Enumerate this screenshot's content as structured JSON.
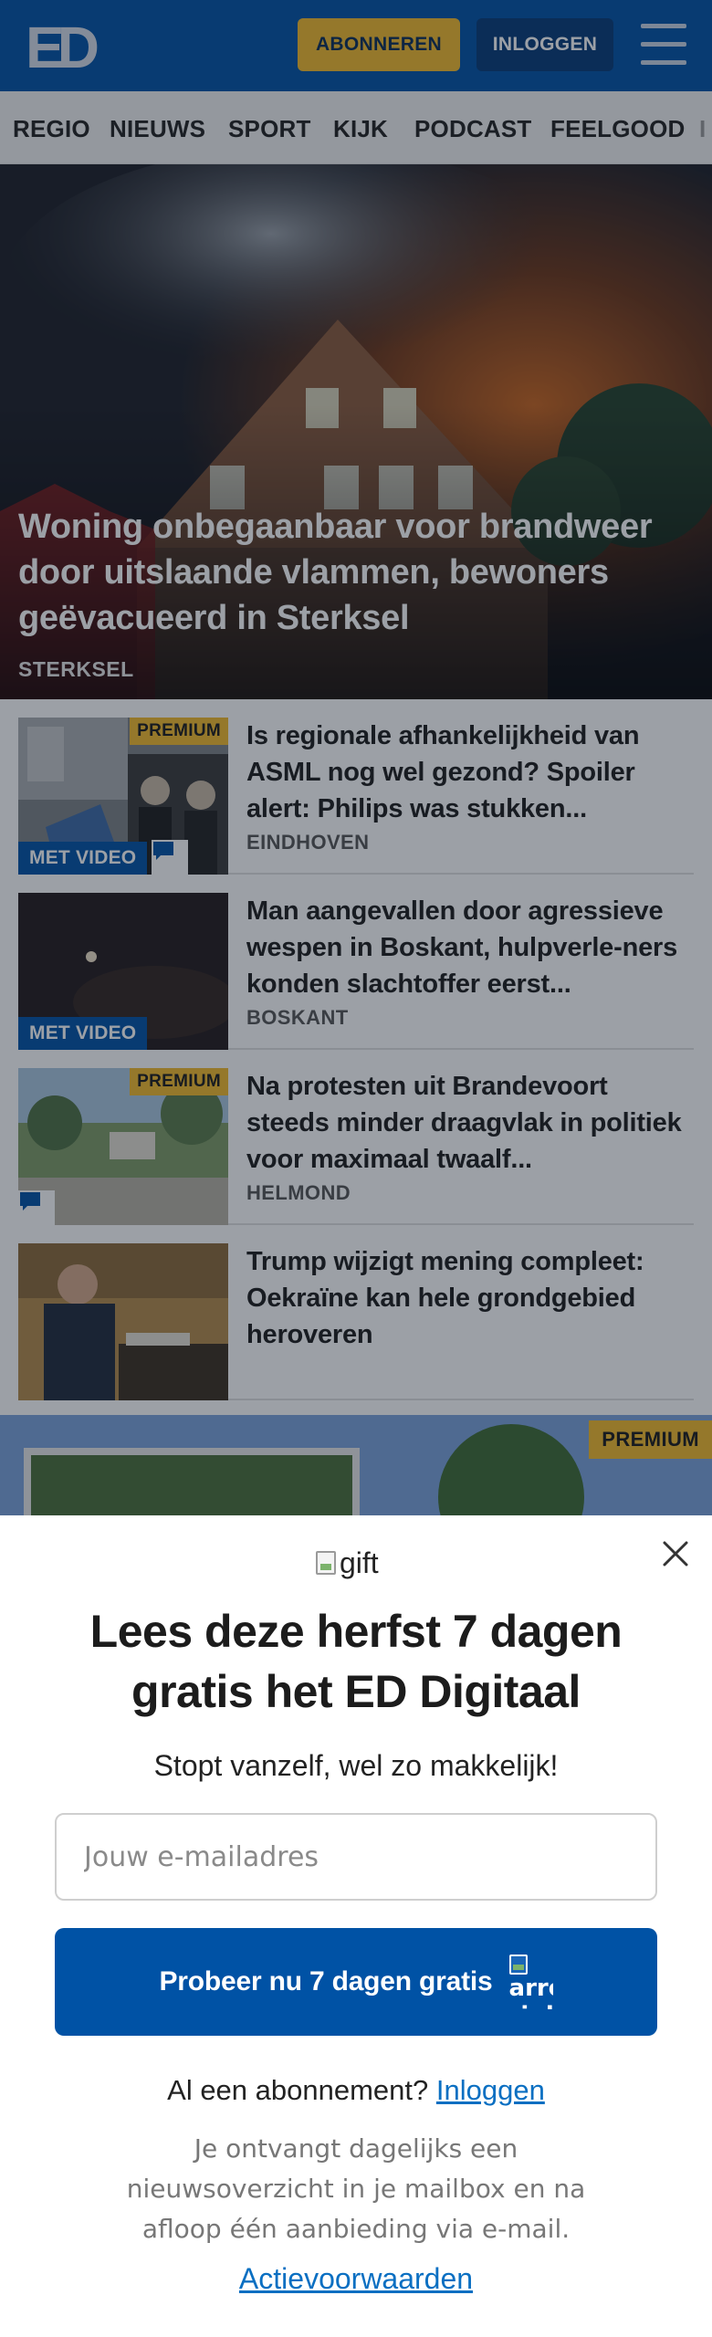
{
  "header": {
    "logo_text": "ED",
    "subscribe_label": "ABONNEREN",
    "login_label": "INLOGGEN",
    "menu_icon": "hamburger-menu-icon"
  },
  "nav": {
    "items": [
      "REGIO",
      "NIEUWS",
      "SPORT",
      "KIJK",
      "PODCAST",
      "FEELGOOD",
      "I"
    ]
  },
  "hero": {
    "title": "Woning onbegaanbaar voor brandweer door uitslaande vlammen, bewoners geëvacueerd in Sterksel",
    "location": "STERKSEL"
  },
  "articles": [
    {
      "title": "Is regionale afhankelijkheid van ASML nog wel gezond? Spoiler alert: Philips was stukken...",
      "location": "EINDHOVEN",
      "premium": "PREMIUM",
      "video": "MET VIDEO",
      "comments_icon": "chat-bubble-icon"
    },
    {
      "title": "Man aangevallen door agressieve wespen in Boskant, hulpverle-ners konden slachtoffer eerst...",
      "location": "BOSKANT",
      "video": "MET VIDEO"
    },
    {
      "title": "Na protesten uit Brandevoort steeds minder draagvlak in politiek voor maximaal twaalf...",
      "location": "HELMOND",
      "premium": "PREMIUM",
      "comments_icon": "chat-bubble-icon"
    },
    {
      "title": "Trump wijzigt mening compleet: Oekraïne kan hele grondgebied heroveren",
      "location": ""
    }
  ],
  "next_article": {
    "premium": "PREMIUM"
  },
  "modal": {
    "gift_alt": "gift",
    "title": "Lees deze herfst 7 dagen gratis het ED Digitaal",
    "subtitle": "Stopt vanzelf, wel zo makkelijk!",
    "email_placeholder": "Jouw e-mailadres",
    "cta_label": "Probeer nu 7 dagen gratis",
    "cta_arrow_alt": "arrow right",
    "has_sub_text": "Al een abonnement?",
    "has_sub_link": "Inloggen",
    "note": "Je ontvangt dagelijks een nieuwsoverzicht in je mailbox en na afloop één aanbieding via e-mail.",
    "terms_link": "Actievoorwaarden"
  },
  "colors": {
    "brand_blue": "#0052a5",
    "accent_yellow": "#f3bb2c",
    "link_blue": "#0a6fc2"
  }
}
